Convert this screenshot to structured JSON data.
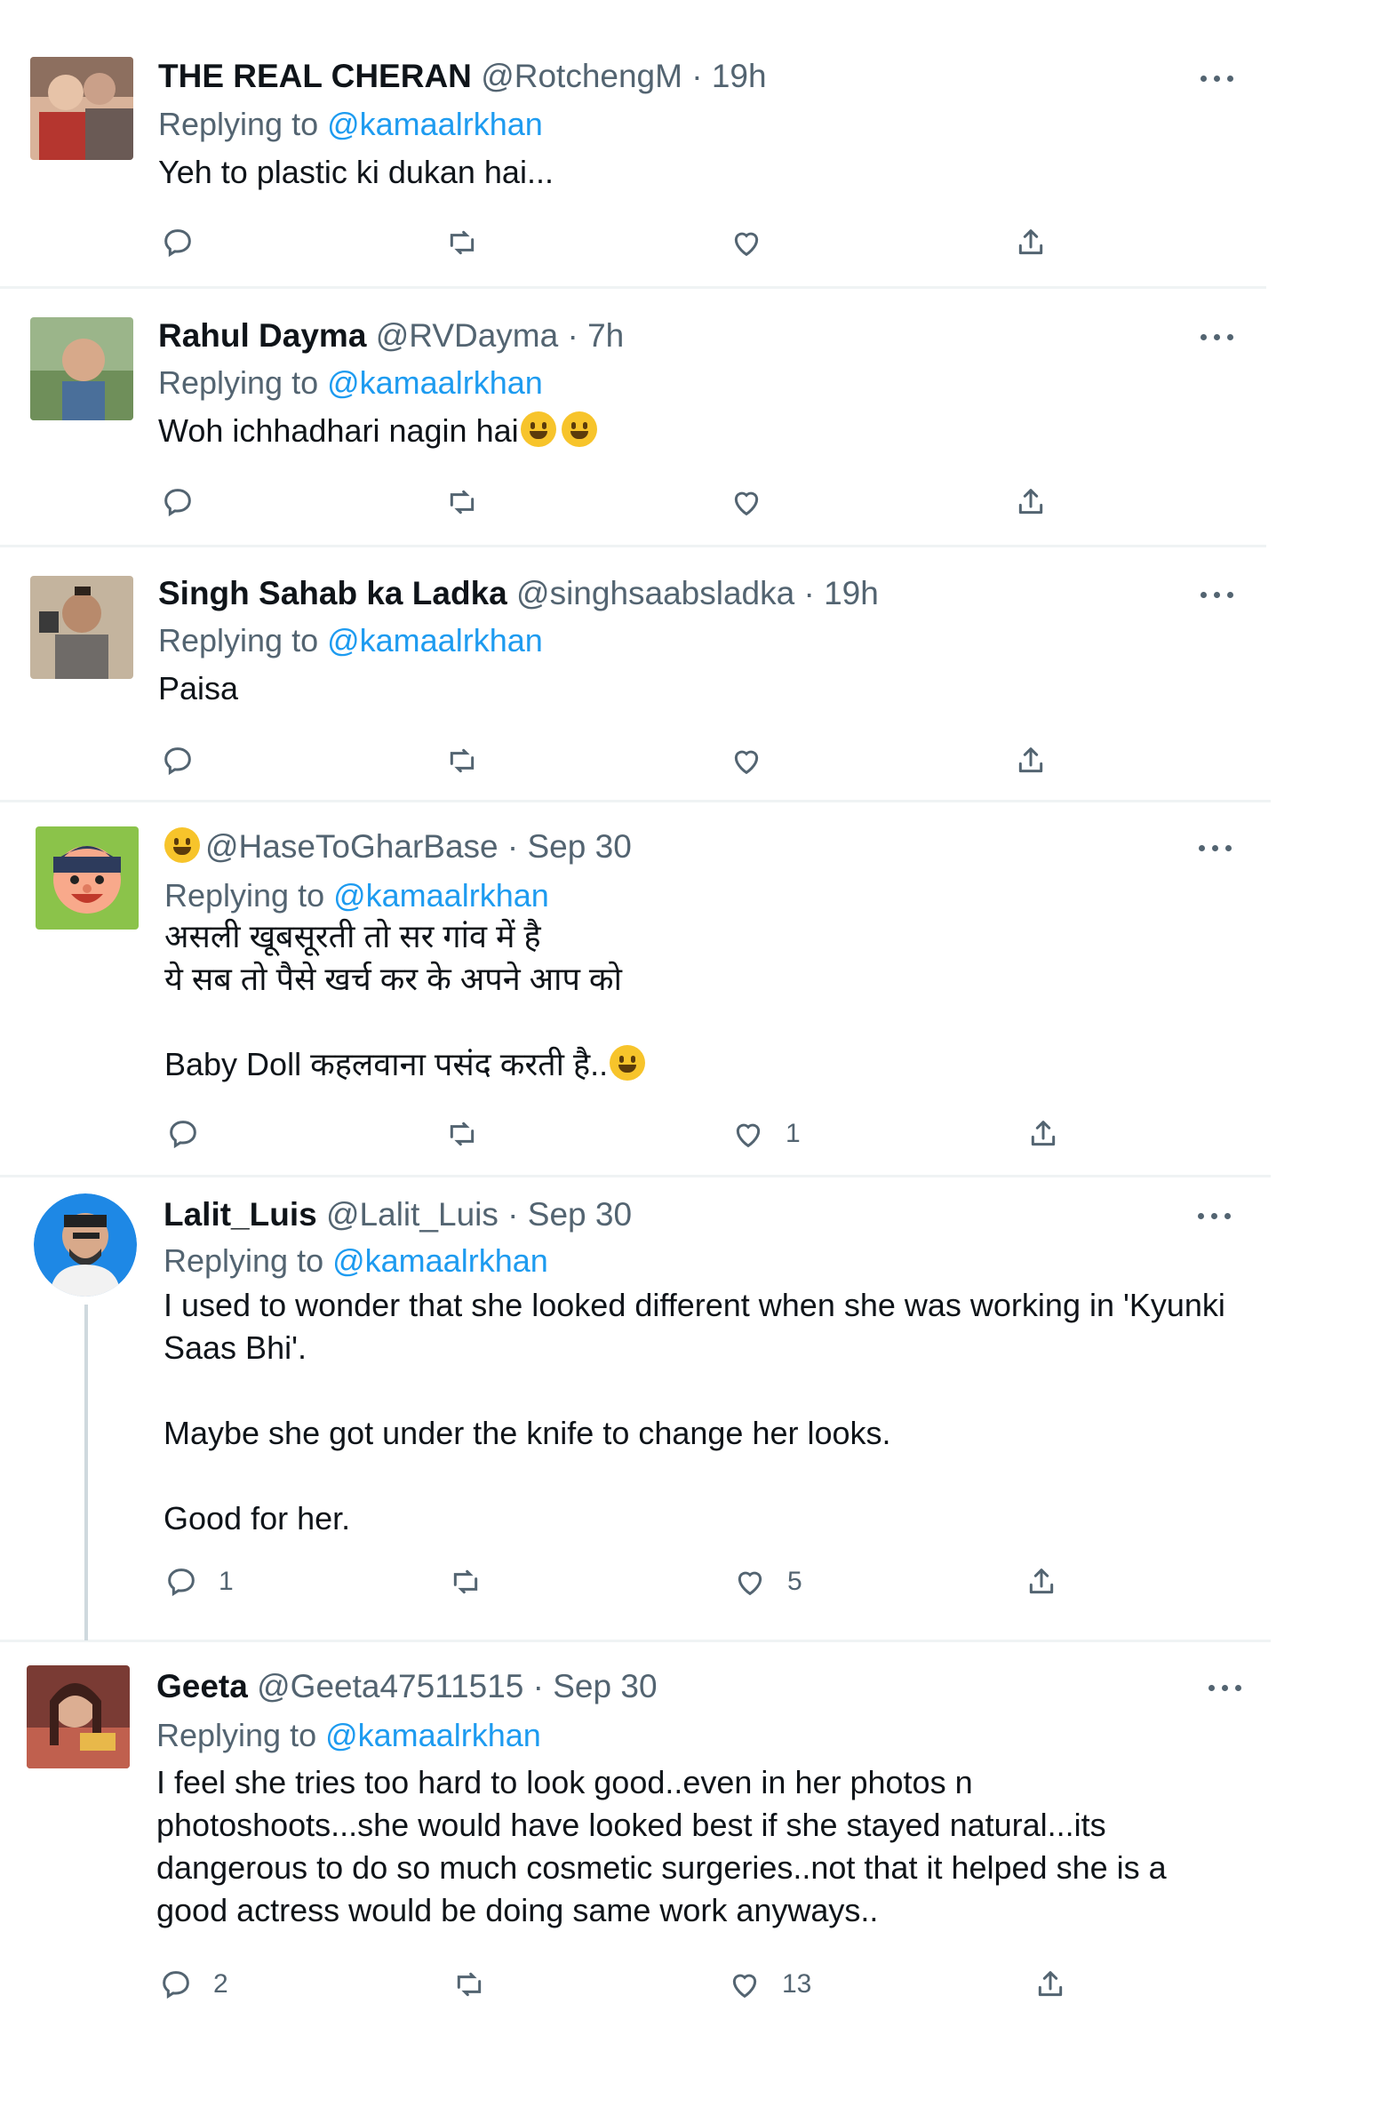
{
  "tweets": [
    {
      "name": "THE REAL CHERAN",
      "handle": "@RotchengM",
      "dot": " · ",
      "time": "19h",
      "replying_label": "Replying to ",
      "replying_to": "@kamaalrkhan",
      "text": "Yeh to plastic ki dukan hai...",
      "replies": "",
      "likes": ""
    },
    {
      "name": "Rahul Dayma",
      "handle": "@RVDayma",
      "dot": " · ",
      "time": "7h",
      "replying_label": "Replying to ",
      "replying_to": "@kamaalrkhan",
      "text": "Woh ichhadhari nagin hai",
      "replies": "",
      "likes": ""
    },
    {
      "name": "Singh Sahab ka Ladka",
      "handle": "@singhsaabsladka",
      "dot": " · ",
      "time": "19h",
      "replying_label": "Replying to ",
      "replying_to": "@kamaalrkhan",
      "text": "Paisa",
      "replies": "",
      "likes": ""
    },
    {
      "name": "",
      "handle": "@HaseToGharBase",
      "dot": " · ",
      "time": "Sep 30",
      "replying_label": "Replying to ",
      "replying_to": "@kamaalrkhan",
      "text": "असली खूबसूरती तो सर गांव में है\nये सब तो पैसे खर्च कर के अपने आप को\n\nBaby Doll कहलवाना पसंद करती है..",
      "replies": "",
      "likes": "1"
    },
    {
      "name": "Lalit_Luis",
      "handle": "@Lalit_Luis",
      "dot": " · ",
      "time": "Sep 30",
      "replying_label": "Replying to ",
      "replying_to": "@kamaalrkhan",
      "text": "I used to wonder that she looked different when she was working in 'Kyunki\nSaas Bhi'.\n\nMaybe she got under the knife to change her looks.\n\nGood for her.",
      "replies": "1",
      "likes": "5"
    },
    {
      "name": "Geeta",
      "handle": "@Geeta47511515",
      "dot": " · ",
      "time": "Sep 30",
      "replying_label": "Replying to ",
      "replying_to": "@kamaalrkhan",
      "text": "I feel she tries too hard to look good..even in her photos n\nphotoshoots...she would have looked best if she stayed natural...its\ndangerous to do so much cosmetic surgeries..not that it helped she is a\ngood actress would be doing same work anyways..",
      "replies": "2",
      "likes": "13"
    }
  ],
  "icons": [
    "reply-icon",
    "retweet-icon",
    "like-icon",
    "share-icon",
    "more-icon"
  ],
  "colors": {
    "mention": "#1d9bf0",
    "secondary": "#536471",
    "text": "#0f1419"
  }
}
